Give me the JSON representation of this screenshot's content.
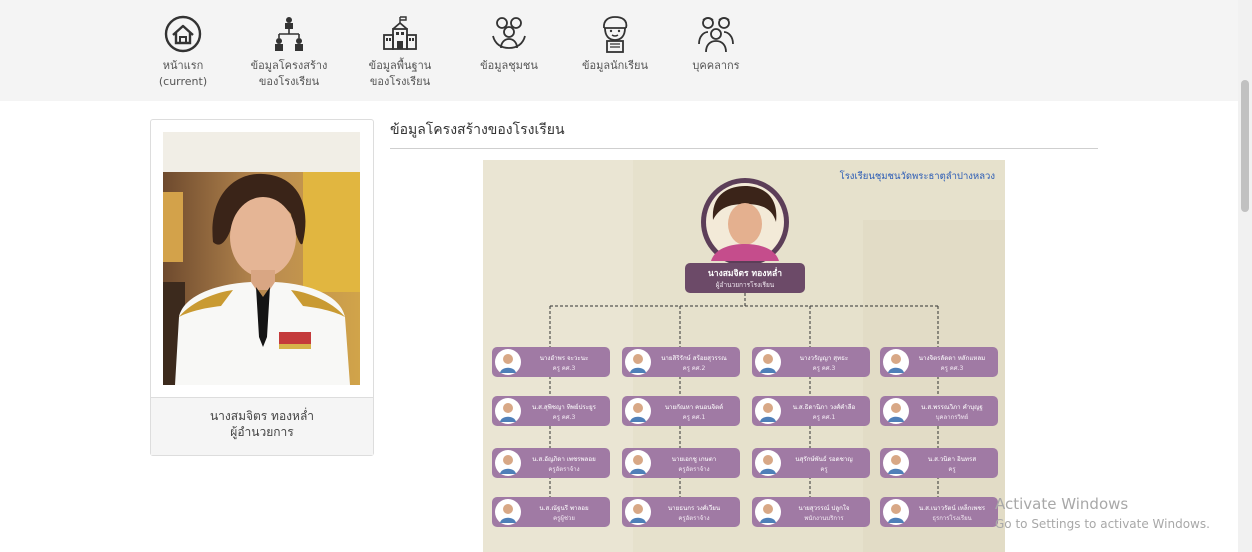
{
  "nav": {
    "items": [
      {
        "line1": "หน้าแรก",
        "line2": "(current)",
        "icon": "home-icon"
      },
      {
        "line1": "ข้อมูลโครงสร้าง",
        "line2": "ของโรงเรียน",
        "icon": "org-structure-icon"
      },
      {
        "line1": "ข้อมูลพื้นฐาน",
        "line2": "ของโรงเรียน",
        "icon": "school-building-icon"
      },
      {
        "line1": "ข้อมูลชุมชน",
        "line2": "",
        "icon": "community-icon"
      },
      {
        "line1": "ข้อมูลนักเรียน",
        "line2": "",
        "icon": "student-icon"
      },
      {
        "line1": "บุคคลากร",
        "line2": "",
        "icon": "personnel-icon"
      }
    ]
  },
  "profile": {
    "name": "นางสมจิตร ทองหล่ำ",
    "position": "ผู้อำนวยการ"
  },
  "section": {
    "title": "ข้อมูลโครงสร้างของโรงเรียน"
  },
  "orgchart": {
    "school_name": "โรงเรียนชุมชนวัดพระธาตุลำปางหลวง",
    "director_name": "นางสมจิตร ทองหล่ำ",
    "director_title": "ผู้อำนวยการโรงเรียน",
    "staff": [
      {
        "name": "นางอำพร จะวะนะ",
        "role": "ครู คศ.3"
      },
      {
        "name": "นายสิริรักษ์ สร้อยสุวรรณ",
        "role": "ครู คศ.2"
      },
      {
        "name": "นางวรัญญา สุทธะ",
        "role": "ครู คศ.3"
      },
      {
        "name": "นางจิตรลัดดา หลักแหลม",
        "role": "ครู คศ.3"
      },
      {
        "name": "น.ส.สุพิชญา ทิพย์ประยูร",
        "role": "ครู คศ.3"
      },
      {
        "name": "นายกัณหา คนอนจิตต์",
        "role": "ครู คศ.1"
      },
      {
        "name": "น.ส.ธิดานิภา วงศ์คำลือ",
        "role": "ครู คศ.1"
      },
      {
        "name": "น.ส.พรรณวิภา คำบุญฐ",
        "role": "บุคลากรวิทย์"
      },
      {
        "name": "น.ส.อัญภิดา เพชรพลอย",
        "role": "ครูอัตราจ้าง"
      },
      {
        "name": "นายเอกชู เกษตา",
        "role": "ครูอัตราจ้าง"
      },
      {
        "name": "นสุรักษ์พันธ์ รอดชาญ",
        "role": "ครู"
      },
      {
        "name": "น.ส.วนิดา อินทรส",
        "role": "ครู"
      },
      {
        "name": "น.ส.ณัฐนรี พาลอย",
        "role": "ครูผู้ช่วย"
      },
      {
        "name": "นายธนกร วงศ์เวียน",
        "role": "ครูอัตราจ้าง"
      },
      {
        "name": "นายสุวรรณ์ ปลูกใจ",
        "role": "พนักงานบริการ"
      },
      {
        "name": "น.ส.เนาวรัตน์ เหล็กเพชร",
        "role": "ธุรการโรงเรียน"
      }
    ]
  },
  "watermark": {
    "line1": "Activate Windows",
    "line2": "Go to Settings to activate Windows."
  },
  "colors": {
    "nav_bg": "#f4f4f4",
    "chart_bg": "#e8e3cf",
    "staff_box": "#a07aa4",
    "director_box": "#6c4a68",
    "school_name": "#2a5bb5"
  }
}
